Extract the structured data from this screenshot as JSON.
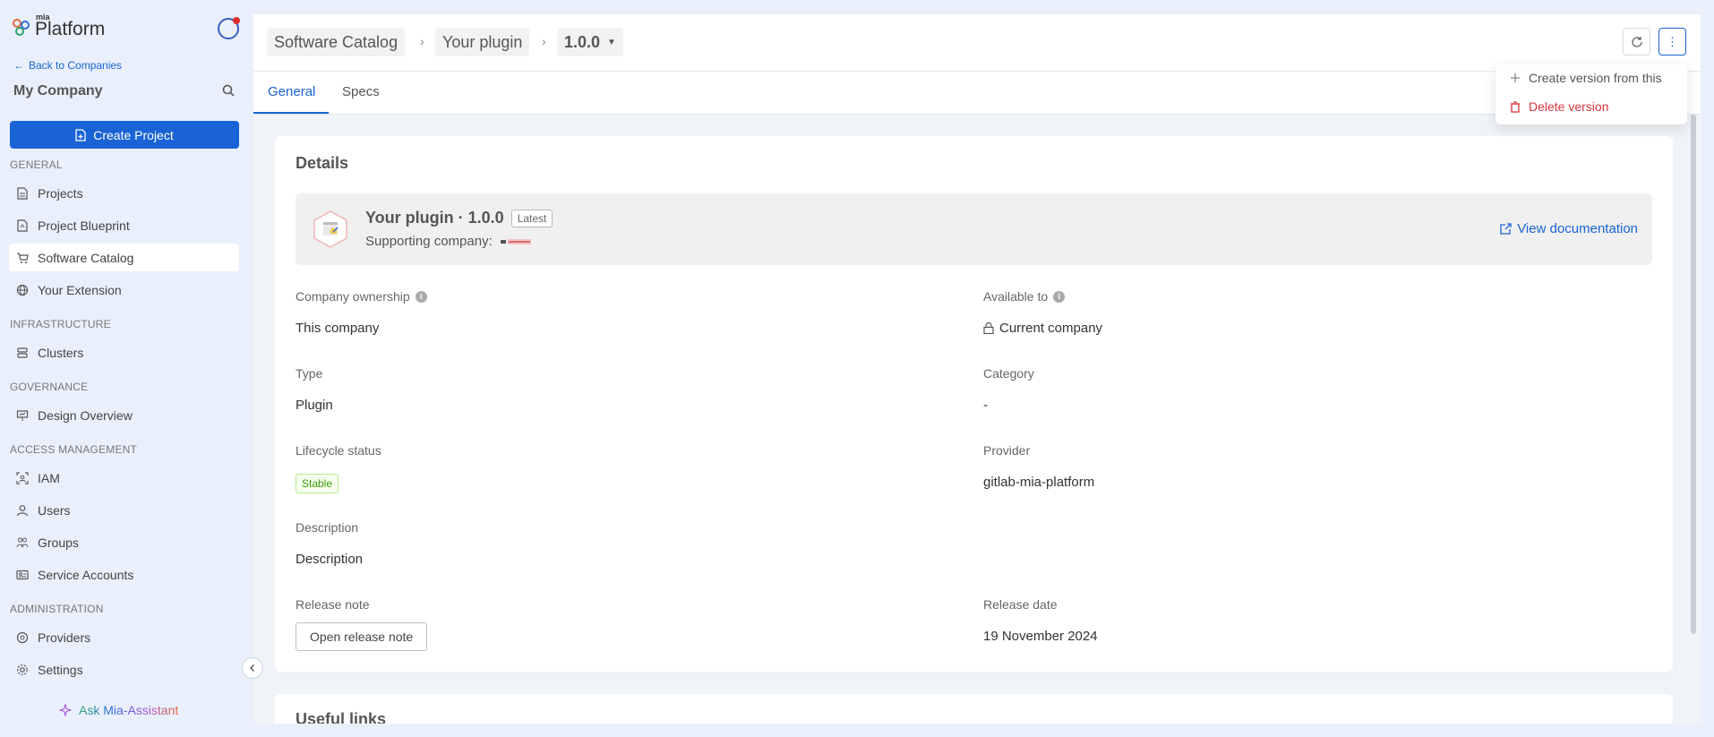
{
  "app": {
    "logo_small": "mia",
    "logo_name": "Platform"
  },
  "sidebar": {
    "back_label": "Back to Companies",
    "company_name": "My Company",
    "create_label": "Create Project",
    "sections": [
      "GENERAL",
      "INFRASTRUCTURE",
      "GOVERNANCE",
      "ACCESS MANAGEMENT",
      "ADMINISTRATION"
    ],
    "items": [
      {
        "label": "Projects",
        "icon": "projects-icon"
      },
      {
        "label": "Project Blueprint",
        "icon": "blueprint-icon"
      },
      {
        "label": "Software Catalog",
        "icon": "cart-icon",
        "active": true
      },
      {
        "label": "Your Extension",
        "icon": "globe-icon"
      },
      {
        "label": "Clusters",
        "icon": "server-icon"
      },
      {
        "label": "Design Overview",
        "icon": "presentation-icon"
      },
      {
        "label": "IAM",
        "icon": "scan-icon"
      },
      {
        "label": "Users",
        "icon": "user-icon"
      },
      {
        "label": "Groups",
        "icon": "group-icon"
      },
      {
        "label": "Service Accounts",
        "icon": "id-card-icon"
      },
      {
        "label": "Providers",
        "icon": "provider-icon"
      },
      {
        "label": "Settings",
        "icon": "gear-icon"
      }
    ],
    "assistant_label": "Ask Mia-Assistant"
  },
  "breadcrumb": [
    "Software Catalog",
    "Your plugin",
    "1.0.0"
  ],
  "tabs": [
    "General",
    "Specs"
  ],
  "menu": {
    "create_label": "Create version from this",
    "delete_label": "Delete version"
  },
  "details": {
    "title": "Details",
    "plugin_title": "Your plugin · 1.0.0",
    "badge": "Latest",
    "supporting_label": "Supporting company:",
    "view_doc": "View documentation",
    "fields": {
      "company_ownership_label": "Company ownership",
      "company_ownership_value": "This company",
      "available_label": "Available to",
      "available_value": "Current company",
      "type_label": "Type",
      "type_value": "Plugin",
      "category_label": "Category",
      "category_value": "-",
      "lifecycle_label": "Lifecycle status",
      "lifecycle_value": "Stable",
      "provider_label": "Provider",
      "provider_value": "gitlab-mia-platform",
      "description_label": "Description",
      "description_value": "Description",
      "release_note_label": "Release note",
      "release_note_button": "Open release note",
      "release_date_label": "Release date",
      "release_date_value": "19 November 2024"
    }
  },
  "useful_links": {
    "title": "Useful links"
  },
  "colors": {
    "primary": "#1a63d6",
    "danger": "#d9363e",
    "stable": "#389e0d"
  }
}
